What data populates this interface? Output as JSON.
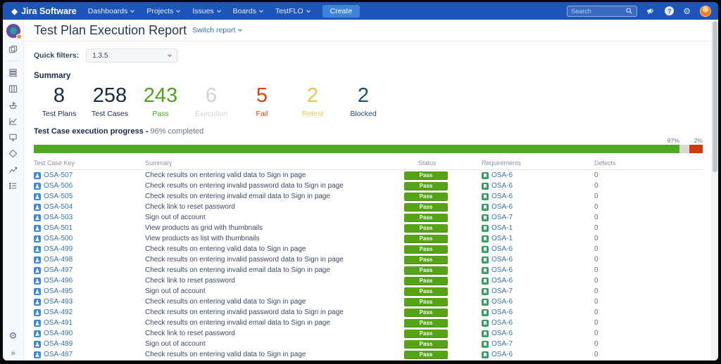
{
  "navbar": {
    "brand": "Jira Software",
    "menus": [
      {
        "label": "Dashboards"
      },
      {
        "label": "Projects"
      },
      {
        "label": "Issues"
      },
      {
        "label": "Boards"
      },
      {
        "label": "TestFLO"
      }
    ],
    "create_label": "Create",
    "search_placeholder": "Search",
    "icons": [
      "search-icon",
      "megaphone-icon",
      "help-icon",
      "settings-icon",
      "user-avatar"
    ],
    "colors": {
      "bar": "#1d56b8",
      "create_button": "#3e83d9"
    }
  },
  "sidebar": {
    "icons": [
      "project-avatar",
      "boards-icon",
      "backlog-icon",
      "board-columns-icon",
      "releases-icon",
      "reports-icon",
      "monitor-icon",
      "components-icon",
      "chart-icon",
      "issues-list-icon",
      "settings-gear-icon",
      "expand-sidebar-icon"
    ]
  },
  "page": {
    "title": "Test Plan Execution Report",
    "switch_label": "Switch report"
  },
  "filters": {
    "label": "Quick filters:",
    "value": "1.3.5"
  },
  "summary": {
    "heading": "Summary",
    "items": [
      {
        "value": "8",
        "label": "Test Plans",
        "color": "#17294d"
      },
      {
        "value": "258",
        "label": "Test Cases",
        "color": "#17294d"
      },
      {
        "value": "243",
        "label": "Pass",
        "color": "#4fa31c"
      },
      {
        "value": "6",
        "label": "Execution",
        "color": "#ccd2da"
      },
      {
        "value": "5",
        "label": "Fail",
        "color": "#d9420b"
      },
      {
        "value": "2",
        "label": "Retest",
        "color": "#eec54c"
      },
      {
        "value": "2",
        "label": "Blocked",
        "color": "#1d4e89"
      }
    ]
  },
  "progress": {
    "title": "Test Case execution progress -",
    "completed": "96% completed",
    "segments": [
      {
        "pct": 96.5,
        "color": "#51a825",
        "label": "97%"
      },
      {
        "pct": 1.5,
        "color": "#d8d8d8",
        "label": ""
      },
      {
        "pct": 2,
        "color": "#d13a0c",
        "label": "2%"
      }
    ]
  },
  "table": {
    "columns": [
      "Test Case Key",
      "Summary",
      "Status",
      "Requirements",
      "Defects"
    ],
    "status_colors": {
      "Pass": "#54a415"
    },
    "rows": [
      {
        "key": "OSA-507",
        "summary": "Check results on entering valid data to Sign in page",
        "status": "Pass",
        "requirement": "OSA-6",
        "defects": "0"
      },
      {
        "key": "OSA-506",
        "summary": "Check results on entering invalid password data to Sign in page",
        "status": "Pass",
        "requirement": "OSA-6",
        "defects": "0"
      },
      {
        "key": "OSA-505",
        "summary": "Check results on entering invalid email data to Sign in page",
        "status": "Pass",
        "requirement": "OSA-6",
        "defects": "0"
      },
      {
        "key": "OSA-504",
        "summary": "Check link to reset password",
        "status": "Pass",
        "requirement": "OSA-6",
        "defects": "0"
      },
      {
        "key": "OSA-503",
        "summary": "Sign out of account",
        "status": "Pass",
        "requirement": "OSA-7",
        "defects": "0"
      },
      {
        "key": "OSA-501",
        "summary": "View products as grid with thumbnails",
        "status": "Pass",
        "requirement": "OSA-1",
        "defects": "0"
      },
      {
        "key": "OSA-500",
        "summary": "View products as list with thumbnails",
        "status": "Pass",
        "requirement": "OSA-1",
        "defects": "0"
      },
      {
        "key": "OSA-499",
        "summary": "Check results on entering valid data to Sign in page",
        "status": "Pass",
        "requirement": "OSA-6",
        "defects": "0"
      },
      {
        "key": "OSA-498",
        "summary": "Check results on entering invalid password data to Sign in page",
        "status": "Pass",
        "requirement": "OSA-6",
        "defects": "0"
      },
      {
        "key": "OSA-497",
        "summary": "Check results on entering invalid email data to Sign in page",
        "status": "Pass",
        "requirement": "OSA-6",
        "defects": "0"
      },
      {
        "key": "OSA-496",
        "summary": "Check link to reset password",
        "status": "Pass",
        "requirement": "OSA-6",
        "defects": "0"
      },
      {
        "key": "OSA-495",
        "summary": "Sign out of account",
        "status": "Pass",
        "requirement": "OSA-7",
        "defects": "0"
      },
      {
        "key": "OSA-493",
        "summary": "Check results on entering valid data to Sign in page",
        "status": "Pass",
        "requirement": "OSA-6",
        "defects": "0"
      },
      {
        "key": "OSA-492",
        "summary": "Check results on entering invalid password data to Sign in page",
        "status": "Pass",
        "requirement": "OSA-6",
        "defects": "0"
      },
      {
        "key": "OSA-491",
        "summary": "Check results on entering invalid email data to Sign in page",
        "status": "Pass",
        "requirement": "OSA-6",
        "defects": "0"
      },
      {
        "key": "OSA-490",
        "summary": "Check link to reset password",
        "status": "Pass",
        "requirement": "OSA-6",
        "defects": "0"
      },
      {
        "key": "OSA-489",
        "summary": "Sign out of account",
        "status": "Pass",
        "requirement": "OSA-7",
        "defects": "0"
      },
      {
        "key": "OSA-487",
        "summary": "Check results on entering valid data to Sign in page",
        "status": "Pass",
        "requirement": "OSA-6",
        "defects": "0"
      }
    ]
  }
}
